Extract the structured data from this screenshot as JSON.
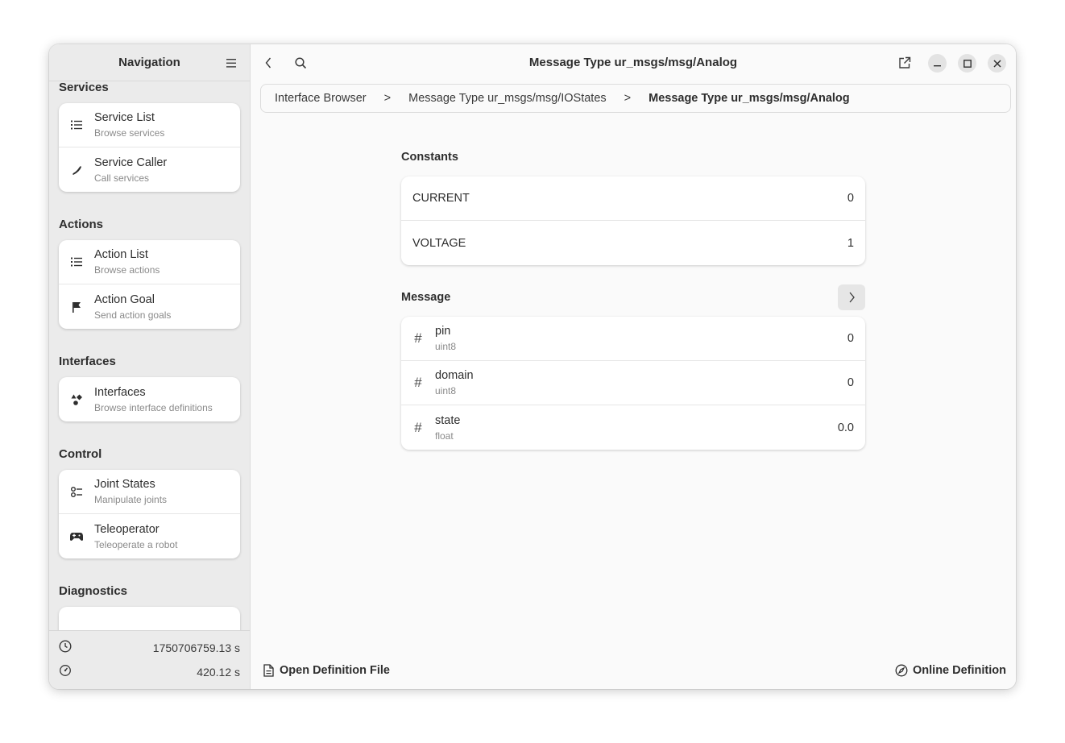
{
  "sidebar": {
    "title": "Navigation",
    "sections": [
      {
        "title": "Services",
        "items": [
          {
            "icon": "list-icon",
            "title": "Service List",
            "subtitle": "Browse services"
          },
          {
            "icon": "phone-icon",
            "title": "Service Caller",
            "subtitle": "Call services"
          }
        ]
      },
      {
        "title": "Actions",
        "items": [
          {
            "icon": "list-icon",
            "title": "Action List",
            "subtitle": "Browse actions"
          },
          {
            "icon": "flag-icon",
            "title": "Action Goal",
            "subtitle": "Send action goals"
          }
        ]
      },
      {
        "title": "Interfaces",
        "items": [
          {
            "icon": "shapes-icon",
            "title": "Interfaces",
            "subtitle": "Browse interface definitions"
          }
        ]
      },
      {
        "title": "Control",
        "items": [
          {
            "icon": "joints-icon",
            "title": "Joint States",
            "subtitle": "Manipulate joints"
          },
          {
            "icon": "gamepad-icon",
            "title": "Teleoperator",
            "subtitle": "Teleoperate a robot"
          }
        ]
      },
      {
        "title": "Diagnostics",
        "items": []
      }
    ],
    "footer": {
      "clock_value": "1750706759.13 s",
      "timer_value": "420.12 s"
    }
  },
  "header": {
    "title": "Message Type ur_msgs/msg/Analog"
  },
  "breadcrumb": {
    "items": [
      "Interface Browser",
      "Message Type ur_msgs/msg/IOStates",
      "Message Type ur_msgs/msg/Analog"
    ],
    "separator": ">"
  },
  "constants": {
    "title": "Constants",
    "rows": [
      {
        "name": "CURRENT",
        "value": "0"
      },
      {
        "name": "VOLTAGE",
        "value": "1"
      }
    ]
  },
  "message": {
    "title": "Message",
    "fields": [
      {
        "name": "pin",
        "type": "uint8",
        "value": "0"
      },
      {
        "name": "domain",
        "type": "uint8",
        "value": "0"
      },
      {
        "name": "state",
        "type": "float",
        "value": "0.0"
      }
    ]
  },
  "bottom": {
    "open_file_label": "Open Definition File",
    "online_label": "Online Definition"
  }
}
